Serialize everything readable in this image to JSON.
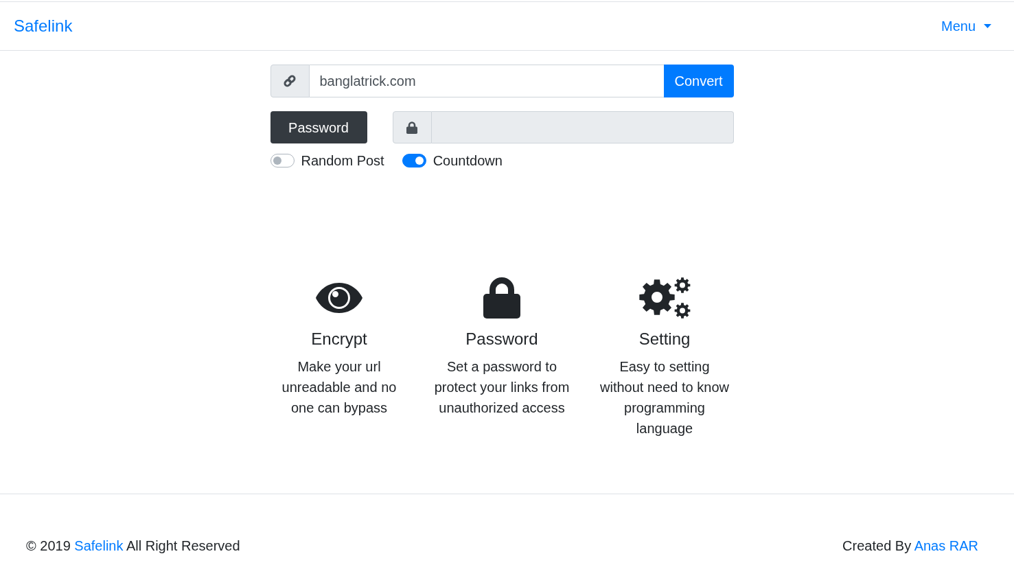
{
  "navbar": {
    "brand": "Safelink",
    "menu": "Menu"
  },
  "url_form": {
    "value": "banglatrick.com",
    "button": "Convert"
  },
  "password_form": {
    "button": "Password",
    "disabled": true
  },
  "toggles": [
    {
      "label": "Random Post",
      "on": false
    },
    {
      "label": "Countdown",
      "on": true
    }
  ],
  "features": [
    {
      "kind": "eye",
      "title": "Encrypt",
      "description": "Make your url unreadable and no one can bypass"
    },
    {
      "kind": "lock",
      "title": "Password",
      "description": "Set a password to protect your links from unauthorized access"
    },
    {
      "kind": "gears",
      "title": "Setting",
      "description": "Easy to setting without need to know programming language"
    }
  ],
  "footer": {
    "copyright": {
      "before": "© 2019",
      "link": "Safelink",
      "after": "All Right Reserved"
    },
    "credit": {
      "before": "Created By",
      "link": "Anas RAR"
    }
  }
}
